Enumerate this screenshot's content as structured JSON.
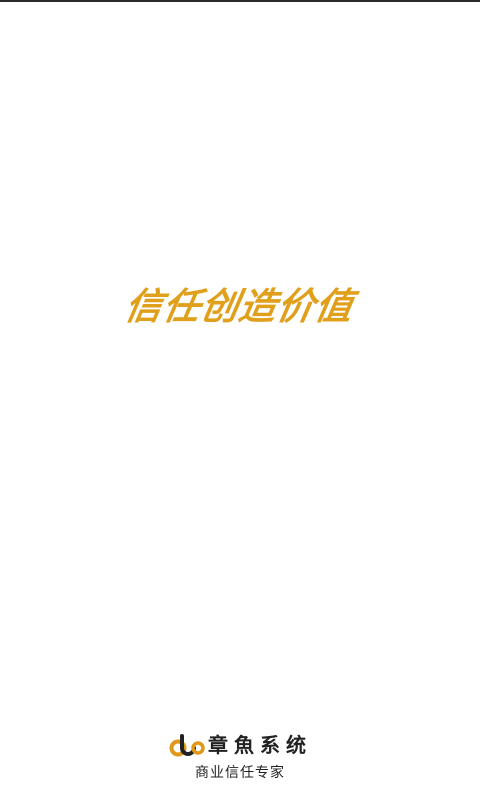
{
  "splash": {
    "slogan": "信任创造价值",
    "brand_name": "章魚系统",
    "tagline": "商业信任专家",
    "logo_icon": "octopus-logo-icon"
  },
  "colors": {
    "slogan": "#e0a01c",
    "logo_orange": "#e0981a",
    "logo_dark": "#222222",
    "text": "#222222",
    "background": "#ffffff"
  }
}
